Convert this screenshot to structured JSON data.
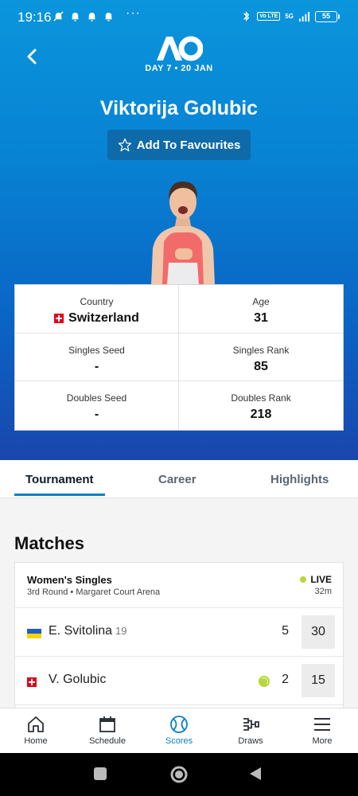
{
  "status_bar": {
    "time": "19:16",
    "dots": "···",
    "battery": "55",
    "volte": "Vo LTE",
    "network": "5G"
  },
  "header": {
    "day_label": "DAY 7 • 20 JAN",
    "player_name": "Viktorija Golubic",
    "favourite_label": "Add To Favourites"
  },
  "stats": [
    {
      "label": "Country",
      "value": "Switzerland",
      "flag": "switzerland"
    },
    {
      "label": "Age",
      "value": "31"
    },
    {
      "label": "Singles Seed",
      "value": "-"
    },
    {
      "label": "Singles Rank",
      "value": "85"
    },
    {
      "label": "Doubles Seed",
      "value": "-"
    },
    {
      "label": "Doubles Rank",
      "value": "218"
    }
  ],
  "tabs": [
    "Tournament",
    "Career",
    "Highlights"
  ],
  "active_tab": "Tournament",
  "matches": {
    "title": "Matches",
    "event": "Women's Singles",
    "round": "3rd Round • Margaret Court Arena",
    "status": "LIVE",
    "duration": "32m",
    "players": [
      {
        "name": "E. Svitolina",
        "seed": "19",
        "flag": "ukraine",
        "set": "5",
        "game": "30",
        "serving": false
      },
      {
        "name": "V. Golubic",
        "seed": "",
        "flag": "switzerland",
        "set": "2",
        "game": "15",
        "serving": true
      }
    ]
  },
  "bottom_nav": [
    {
      "label": "Home",
      "icon": "home-icon"
    },
    {
      "label": "Schedule",
      "icon": "calendar-icon"
    },
    {
      "label": "Scores",
      "icon": "tennis-ball-icon"
    },
    {
      "label": "Draws",
      "icon": "bracket-icon"
    },
    {
      "label": "More",
      "icon": "menu-icon"
    }
  ],
  "active_nav": "Scores",
  "colors": {
    "accent": "#0a7fc7",
    "live": "#b7d63b",
    "hero_top": "#0a95dc",
    "hero_bottom": "#1a46ad"
  }
}
